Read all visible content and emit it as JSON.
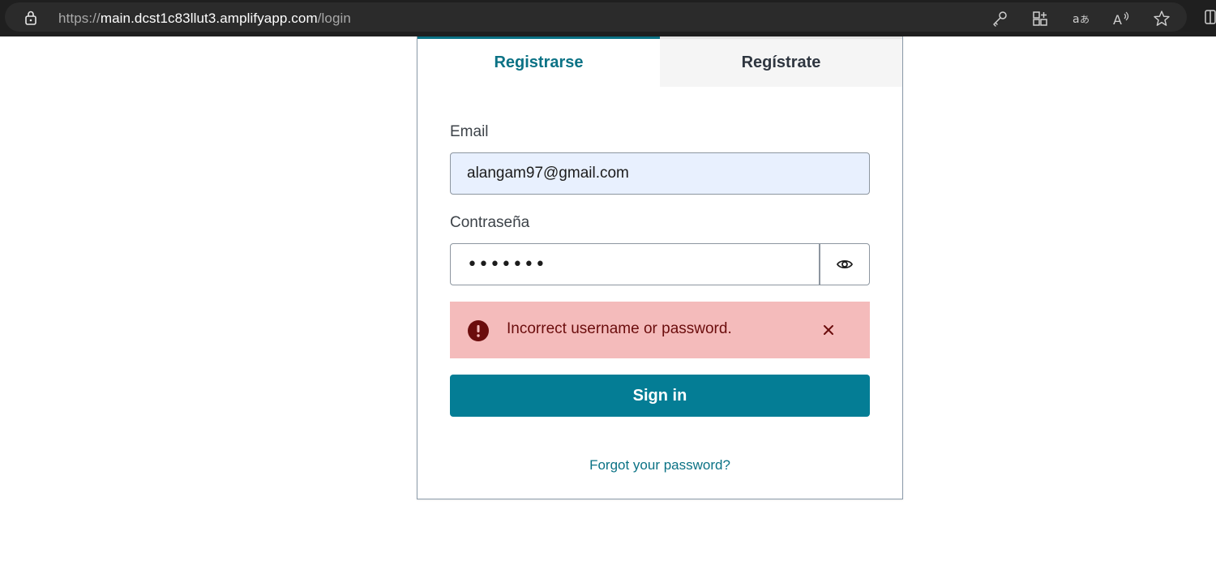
{
  "browser": {
    "url_prefix": "https://",
    "url_host": "main.dcst1c83llut3.amplifyapp.com",
    "url_path": "/login",
    "icons": [
      "lock-icon",
      "key-icon",
      "apps-icon",
      "translate-icon",
      "read-aloud-icon",
      "favorite-star-icon"
    ]
  },
  "tabs": [
    {
      "label": "Registrarse",
      "active": true
    },
    {
      "label": "Regístrate",
      "active": false
    }
  ],
  "form": {
    "email_label": "Email",
    "email_value": "alangam97@gmail.com",
    "password_label": "Contraseña",
    "password_value": "•••••••"
  },
  "alert": {
    "message": "Incorrect username or password.",
    "icon": "error-icon",
    "color": "#f4bbbb"
  },
  "actions": {
    "signin_label": "Sign in",
    "forgot_label": "Forgot your password?"
  },
  "colors": {
    "accent": "#047d95",
    "alert_bg": "#f4bbbb",
    "alert_text": "#6b0d0d",
    "input_autofill": "#e8f0fe"
  }
}
